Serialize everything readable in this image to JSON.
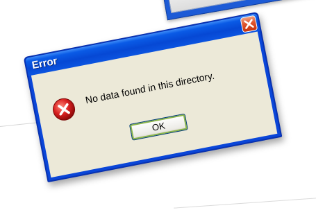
{
  "dialog": {
    "title": "Error",
    "message": "No data found in this directory.",
    "ok_label": "OK",
    "icon": "error-icon",
    "close_icon": "close-icon"
  },
  "colors": {
    "titlebar": "#0648d4",
    "client_bg": "#ece9d8",
    "close_button": "#e0562e",
    "error_icon": "#c81818"
  }
}
